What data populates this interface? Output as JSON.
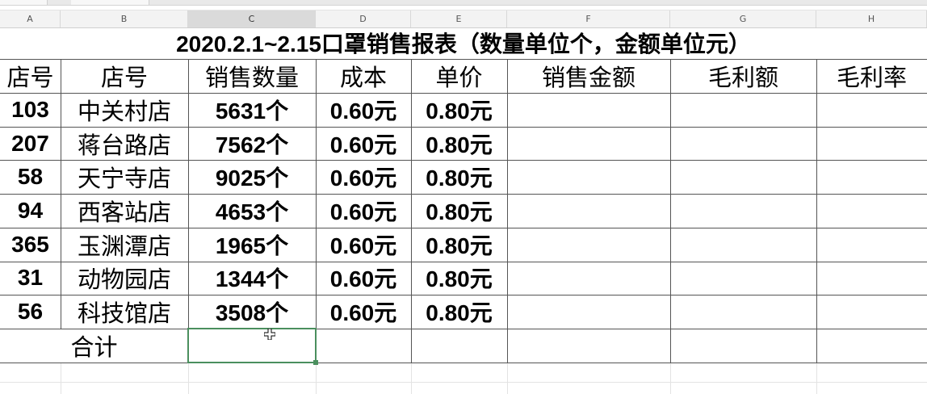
{
  "columns": [
    "A",
    "B",
    "C",
    "D",
    "E",
    "F",
    "G",
    "H"
  ],
  "title": "2020.2.1~2.15口罩销售报表（数量单位个，金额单位元）",
  "headers": [
    "店号",
    "店号",
    "销售数量",
    "成本",
    "单价",
    "销售金额",
    "毛利额",
    "毛利率"
  ],
  "rows": [
    {
      "id": "103",
      "store": "中关村店",
      "qty": "5631个",
      "cost": "0.60元",
      "price": "0.80元"
    },
    {
      "id": "207",
      "store": "蒋台路店",
      "qty": "7562个",
      "cost": "0.60元",
      "price": "0.80元"
    },
    {
      "id": "58",
      "store": "天宁寺店",
      "qty": "9025个",
      "cost": "0.60元",
      "price": "0.80元"
    },
    {
      "id": "94",
      "store": "西客站店",
      "qty": "4653个",
      "cost": "0.60元",
      "price": "0.80元"
    },
    {
      "id": "365",
      "store": "玉渊潭店",
      "qty": "1965个",
      "cost": "0.60元",
      "price": "0.80元"
    },
    {
      "id": "31",
      "store": "动物园店",
      "qty": "1344个",
      "cost": "0.60元",
      "price": "0.80元"
    },
    {
      "id": "56",
      "store": "科技馆店",
      "qty": "3508个",
      "cost": "0.60元",
      "price": "0.80元"
    }
  ],
  "total_label": "合计",
  "selected_cell": "C",
  "accent_color": "#4a8f5e",
  "cursor_icon": "cell-select-cross-icon"
}
